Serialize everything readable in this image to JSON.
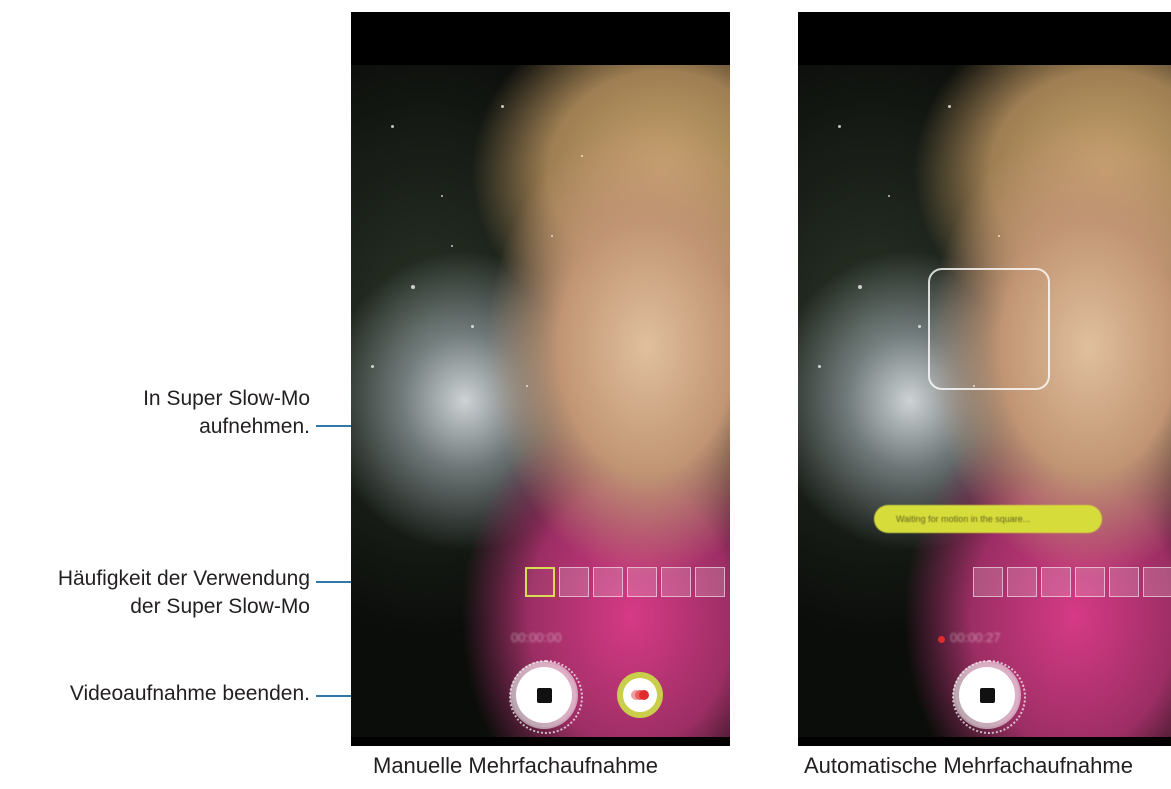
{
  "labels": {
    "slowmo_record": [
      "In Super Slow-Mo",
      "aufnehmen."
    ],
    "usage_frequency": [
      "Häufigkeit der Verwendung",
      "der Super Slow-Mo"
    ],
    "stop_recording": "Videoaufnahme beenden."
  },
  "captions": {
    "manual": "Manuelle Mehrfachaufnahme",
    "automatic": "Automatische Mehrfachaufnahme"
  },
  "screens": {
    "manual": {
      "timer": "00:00:00",
      "frames_total": 6,
      "frames_used": 1
    },
    "automatic": {
      "timer": "00:00:27",
      "toast": "Waiting for motion in the square...",
      "frames_total": 6,
      "frames_used": 0
    }
  },
  "colors": {
    "callout": "#2f78a8",
    "frame_active": "#d8dc55",
    "slowmo_button": "#c9cf4a",
    "record_dot": "#e02b2b"
  },
  "icons": {
    "stop": "stop-square-icon",
    "slowmo": "slowmo-dots-icon"
  }
}
